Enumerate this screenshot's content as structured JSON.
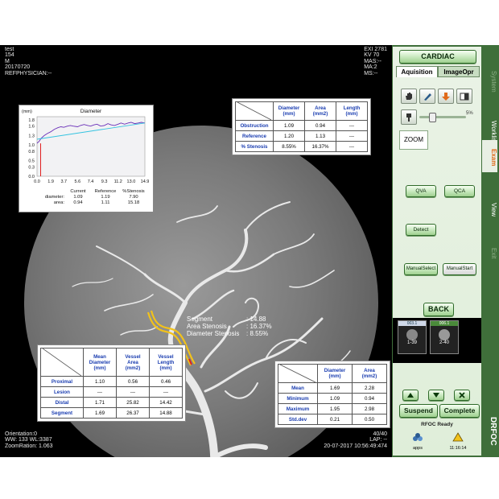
{
  "overlay": {
    "top_left": [
      "test",
      "154",
      "M",
      "20170720",
      "REFPHYSICIAN:--"
    ],
    "top_right": [
      "EXI 2781",
      "KV 70",
      "MAS:--",
      "MA:2",
      "MS:--"
    ],
    "bottom_left": [
      "Orientation:0",
      "WW: 133  WL:3387",
      "ZoomRation: 1.063"
    ],
    "bottom_right": [
      "40/40",
      "LAP: --",
      "20-07-2017  10:56:49:474"
    ],
    "segment_label": "Segment",
    "segment_value": ": 14.88",
    "area_stenosis_label": "Area Stenosis",
    "area_stenosis_value": ": 16.37%",
    "diam_stenosis_label": "Diameter Stenosis",
    "diam_stenosis_value": ": 8.55%"
  },
  "diameter_chart": {
    "unit_label": "(mm)",
    "title": "Diameter",
    "summary_headers": [
      "Current",
      "Reference",
      "%Stenosis"
    ],
    "summary_rows": [
      {
        "label": "diameter:",
        "values": [
          "1.09",
          "1.19",
          "7.90"
        ]
      },
      {
        "label": "area:",
        "values": [
          "0.94",
          "1.11",
          "15.18"
        ]
      }
    ]
  },
  "chart_data": {
    "type": "line",
    "title": "Diameter",
    "ylabel": "(mm)",
    "xlabel": "",
    "x_ticks": [
      "0.0",
      "1.9",
      "3.7",
      "5.6",
      "7.4",
      "9.3",
      "11.2",
      "13.0",
      "14.9"
    ],
    "y_ticks": [
      "0.0",
      "0.3",
      "0.5",
      "0.8",
      "1.0",
      "1.3",
      "1.6",
      "1.8"
    ],
    "xlim": [
      0,
      14.9
    ],
    "ylim": [
      0,
      1.9
    ],
    "grid": false,
    "series": [
      {
        "color": "#6a2fb8",
        "x": [
          0,
          0.3,
          0.6,
          1.0,
          1.4,
          1.9,
          2.4,
          2.9,
          3.3,
          3.7,
          4.2,
          4.6,
          5.0,
          5.6,
          6.0,
          6.5,
          7.0,
          7.4,
          7.9,
          8.3,
          8.8,
          9.3,
          9.8,
          10.2,
          10.7,
          11.2,
          11.6,
          12.1,
          12.6,
          13.0,
          13.5,
          14.0,
          14.4,
          14.9
        ],
        "y": [
          1.05,
          1.12,
          1.22,
          1.3,
          1.36,
          1.42,
          1.5,
          1.55,
          1.58,
          1.56,
          1.6,
          1.62,
          1.6,
          1.58,
          1.62,
          1.65,
          1.62,
          1.6,
          1.64,
          1.66,
          1.6,
          1.62,
          1.68,
          1.64,
          1.62,
          1.66,
          1.7,
          1.66,
          1.7,
          1.72,
          1.68,
          1.7,
          1.72,
          1.7
        ]
      },
      {
        "color": "#33c3e0",
        "x": [
          0,
          14.9
        ],
        "y": [
          1.18,
          1.7
        ]
      },
      {
        "color": "#e02020",
        "x": [
          0.5,
          0.5
        ],
        "y": [
          0,
          1.05
        ]
      }
    ]
  },
  "obstruction_table": {
    "headers": [
      [
        "Diameter",
        "(mm)"
      ],
      [
        "Area",
        "(mm2)"
      ],
      [
        "Length",
        "(mm)"
      ]
    ],
    "rows": [
      {
        "label": "Obstruction",
        "values": [
          "1.09",
          "0.94",
          "---"
        ]
      },
      {
        "label": "Reference",
        "values": [
          "1.20",
          "1.13",
          "---"
        ]
      },
      {
        "label": "% Stenosis",
        "values": [
          "8.55%",
          "16.37%",
          "---"
        ]
      }
    ]
  },
  "vessel_table": {
    "headers": [
      [
        "Mean",
        "Diameter",
        "(mm)"
      ],
      [
        "Vessel",
        "Area",
        "(mm2)"
      ],
      [
        "Vessel",
        "Length",
        "(mm)"
      ]
    ],
    "rows": [
      {
        "label": "Proximal",
        "values": [
          "1.10",
          "0.56",
          "0.46"
        ]
      },
      {
        "label": "Lesion",
        "values": [
          "---",
          "---",
          "---"
        ]
      },
      {
        "label": "Distal",
        "values": [
          "1.71",
          "25.82",
          "14.42"
        ]
      },
      {
        "label": "Segment",
        "values": [
          "1.69",
          "26.37",
          "14.88"
        ]
      }
    ]
  },
  "stats_table": {
    "headers": [
      [
        "Diameter",
        "(mm)"
      ],
      [
        "Area",
        "(mm2)"
      ]
    ],
    "rows": [
      {
        "label": "Mean",
        "values": [
          "1.69",
          "2.28"
        ]
      },
      {
        "label": "Minimum",
        "values": [
          "1.09",
          "0.94"
        ]
      },
      {
        "label": "Maximum",
        "values": [
          "1.95",
          "2.98"
        ]
      },
      {
        "label": "Std.dev",
        "values": [
          "0.21",
          "0.50"
        ]
      }
    ]
  },
  "control_panel": {
    "cardiac_label": "CARDIAC",
    "tab_acquisition": "Aquisition",
    "tab_imageopr": "ImageOpr",
    "slider_value": "5%",
    "zoom_label": "ZOOM",
    "qva_label": "QVA",
    "qca_label": "QCA",
    "detect_label": "Detect",
    "manual_select_label": "ManualSelect",
    "manual_start_label": "ManualStart",
    "back_label": "BACK",
    "thumb1_header": "003.1",
    "thumb2_header": "006.1",
    "thumb1_caption": "1-39",
    "thumb2_caption": "2-40",
    "suspend_label": "Suspend",
    "complete_label": "Complete",
    "status_label": "RFOC Ready",
    "apps_label": "apps",
    "clock": "11:16:14",
    "side_tabs": [
      "System",
      "Worklist",
      "Exam",
      "View",
      "Exit"
    ],
    "brand": "DRFOC"
  },
  "colors": {
    "panel_green": "#3f6f3a",
    "button_green": "#9fd08f",
    "header_blue": "#1a3db0",
    "stenosis_red": "#e02020",
    "highlight_yellow": "#f2c21a"
  }
}
